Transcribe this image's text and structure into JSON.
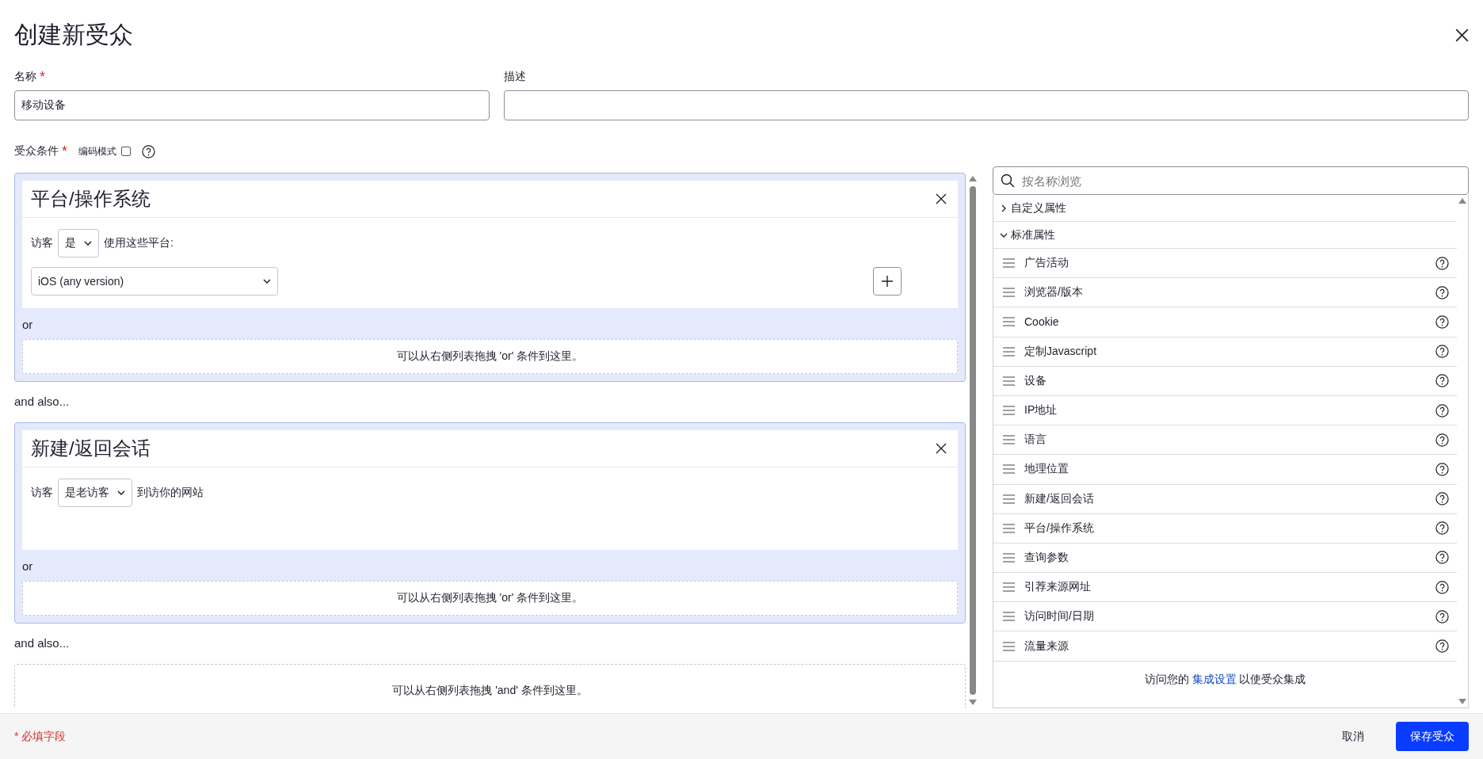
{
  "dialog": {
    "title": "创建新受众"
  },
  "fields": [
    {
      "label": "名称",
      "required_mark": "*",
      "value": "移动设备"
    },
    {
      "label": "描述"
    }
  ],
  "conditions": {
    "label": "受众条件",
    "required_mark": "*",
    "code_mode": {
      "label": "编码模式",
      "checked": false
    }
  },
  "groups": [
    {
      "title": "平台/操作系统",
      "parts": [
        {
          "kind": "text",
          "text": "访客"
        },
        {
          "kind": "select",
          "value": "是"
        },
        {
          "kind": "text",
          "text": "使用这些平台:"
        }
      ],
      "platform_select": "iOS (any version)",
      "add_button": true,
      "or_label": "or",
      "or_drop": "可以从右侧列表拖拽 'or' 条件到这里。"
    },
    {
      "title": "新建/返回会话",
      "parts": [
        {
          "kind": "text",
          "text": "访客"
        },
        {
          "kind": "select",
          "value": "是老访客"
        },
        {
          "kind": "text",
          "text": "到访你的网站"
        }
      ],
      "add_button": false,
      "or_label": "or",
      "or_drop": "可以从右侧列表拖拽 'or' 条件到这里。"
    }
  ],
  "and_labels": [
    "and also...",
    "and also..."
  ],
  "and_drop": "可以从右侧列表拖拽 'and' 条件到这里。",
  "browser": {
    "search_placeholder": "按名称浏览",
    "categories": [
      {
        "label": "自定义属性",
        "expanded": false
      },
      {
        "label": "标准属性",
        "expanded": true,
        "items": [
          "广告活动",
          "浏览器/版本",
          "Cookie",
          "定制Javascript",
          "设备",
          "IP地址",
          "语言",
          "地理位置",
          "新建/返回会话",
          "平台/操作系统",
          "查询参数",
          "引荐来源网址",
          "访问时间/日期",
          "流量来源"
        ]
      }
    ],
    "footer": {
      "prefix": "访问您的",
      "link": "集成设置",
      "suffix": "以使受众集成"
    }
  },
  "footer": {
    "required_note": "* 必填字段",
    "buttons": [
      {
        "label": "取消",
        "kind": "secondary"
      },
      {
        "label": "保存受众",
        "kind": "primary"
      }
    ]
  }
}
